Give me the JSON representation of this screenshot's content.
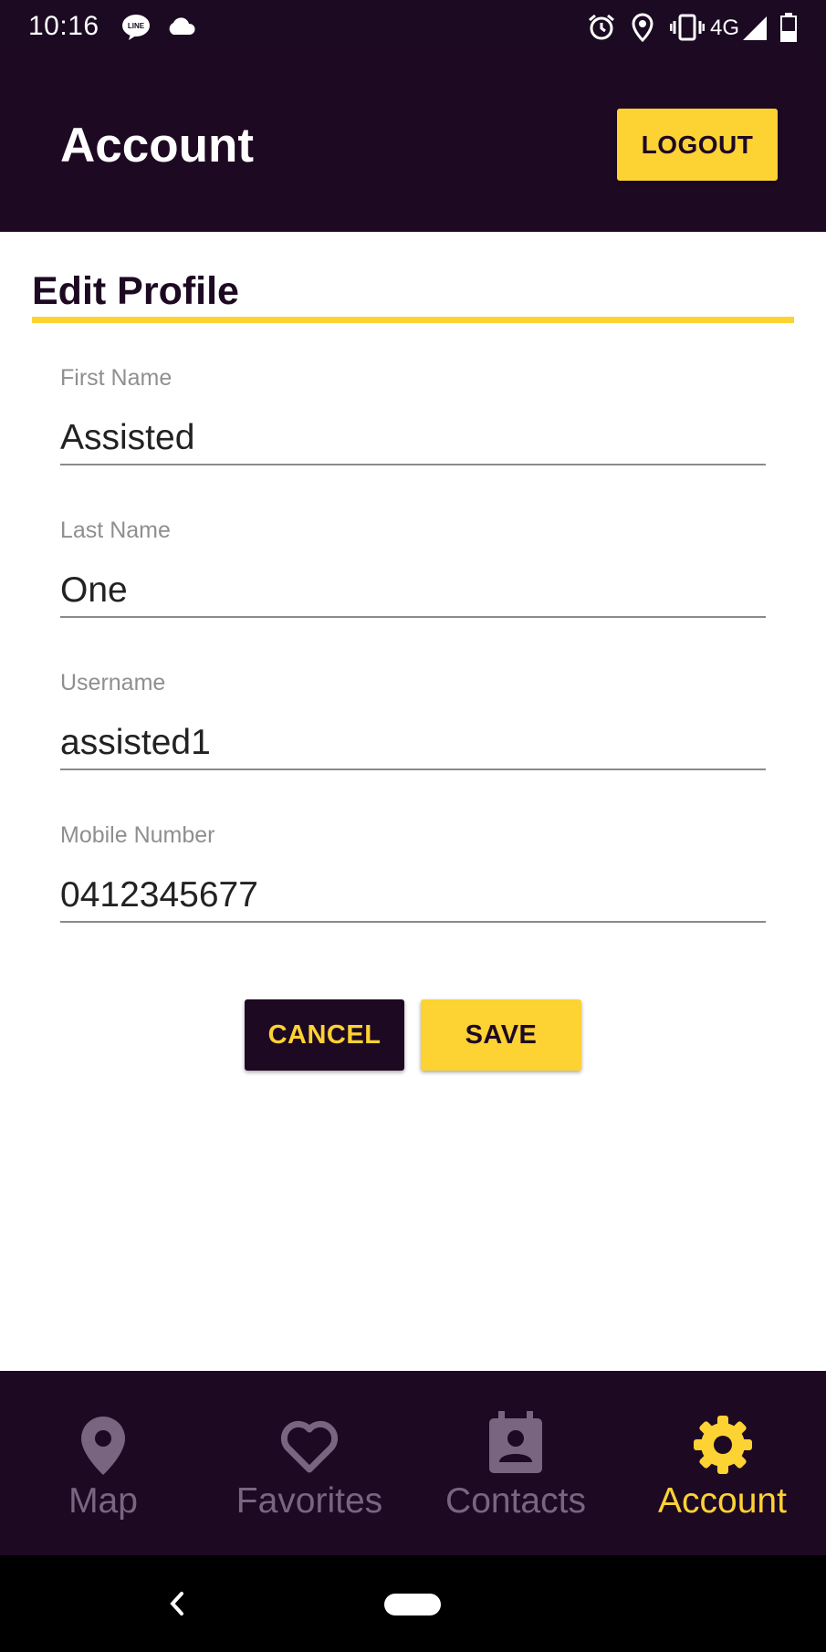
{
  "status_bar": {
    "time": "10:16",
    "network": "4G",
    "icons": [
      "line-app-icon",
      "cloud-icon",
      "alarm-icon",
      "location-icon",
      "vibrate-icon",
      "signal-icon",
      "battery-icon"
    ]
  },
  "app_bar": {
    "title": "Account",
    "logout_label": "LOGOUT"
  },
  "section": {
    "title": "Edit Profile"
  },
  "form": {
    "first_name": {
      "label": "First Name",
      "value": "Assisted"
    },
    "last_name": {
      "label": "Last Name",
      "value": "One"
    },
    "username": {
      "label": "Username",
      "value": "assisted1"
    },
    "mobile": {
      "label": "Mobile Number",
      "value": "0412345677"
    }
  },
  "actions": {
    "cancel_label": "CANCEL",
    "save_label": "SAVE"
  },
  "bottom_nav": {
    "items": [
      {
        "label": "Map",
        "icon": "map-pin-icon",
        "active": false
      },
      {
        "label": "Favorites",
        "icon": "heart-icon",
        "active": false
      },
      {
        "label": "Contacts",
        "icon": "contacts-icon",
        "active": false
      },
      {
        "label": "Account",
        "icon": "gear-icon",
        "active": true
      }
    ]
  },
  "colors": {
    "primary_dark": "#1e0923",
    "accent_yellow": "#fdd233",
    "inactive_nav": "#7a6580"
  }
}
